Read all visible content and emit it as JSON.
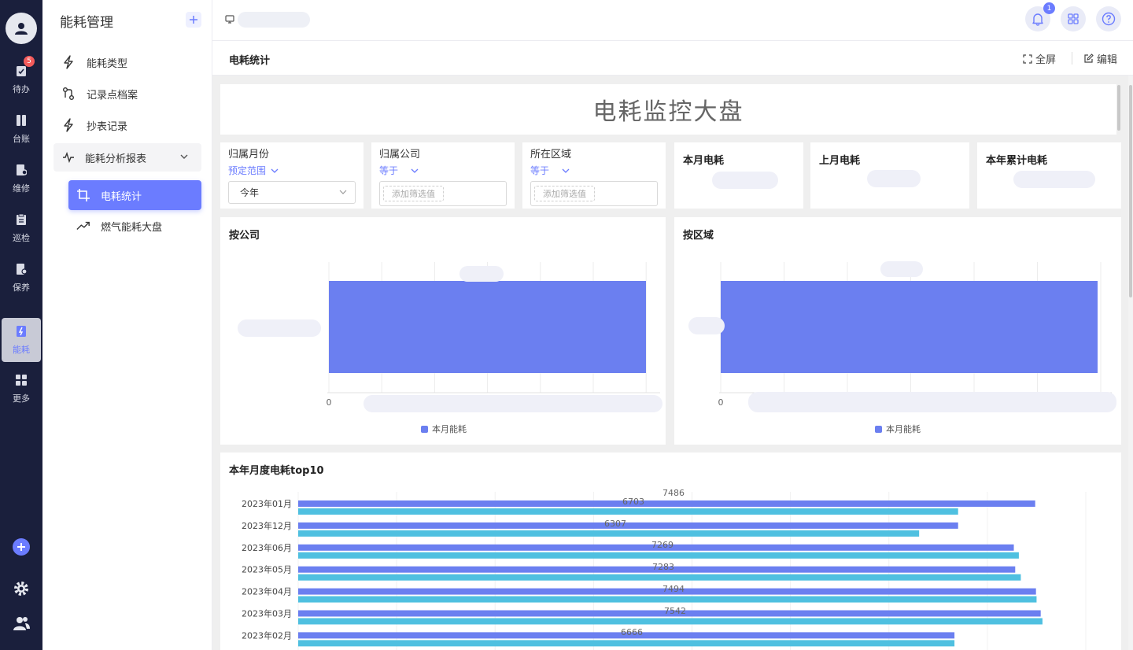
{
  "rail": {
    "items": [
      {
        "label": "待办",
        "icon": "clipboard-check-icon",
        "badge": "5"
      },
      {
        "label": "台账",
        "icon": "ledger-icon"
      },
      {
        "label": "维修",
        "icon": "repair-doc-icon"
      },
      {
        "label": "巡检",
        "icon": "inspection-icon"
      },
      {
        "label": "保养",
        "icon": "maintenance-icon"
      },
      {
        "label": "能耗",
        "icon": "energy-icon"
      },
      {
        "label": "更多",
        "icon": "grid-more-icon"
      }
    ]
  },
  "sidebar": {
    "title": "能耗管理",
    "items": [
      {
        "label": "能耗类型",
        "icon": "lightning-icon"
      },
      {
        "label": "记录点档案",
        "icon": "branch-icon"
      },
      {
        "label": "抄表记录",
        "icon": "lightning-icon"
      },
      {
        "label": "能耗分析报表",
        "icon": "activity-icon"
      }
    ],
    "subitems": [
      {
        "label": "电耗统计",
        "icon": "crop-icon"
      },
      {
        "label": "燃气能耗大盘",
        "icon": "trend-up-icon"
      }
    ]
  },
  "header": {
    "notification_count": "1"
  },
  "page": {
    "title": "电耗统计",
    "fullscreen_label": "全屏",
    "edit_label": "编辑"
  },
  "dashboard": {
    "banner": "电耗监控大盘",
    "filters": [
      {
        "label": "归属月份",
        "operator": "预定范围",
        "value": "今年"
      },
      {
        "label": "归属公司",
        "operator": "等于",
        "placeholder": "添加筛选值"
      },
      {
        "label": "所在区域",
        "operator": "等于",
        "placeholder": "添加筛选值"
      }
    ],
    "kpis": [
      {
        "title": "本月电耗"
      },
      {
        "title": "上月电耗"
      },
      {
        "title": "本年累计电耗"
      }
    ]
  },
  "chart_data": [
    {
      "type": "bar",
      "title": "按公司",
      "orientation": "horizontal",
      "x_tick_labels": [
        "0"
      ],
      "series": [
        {
          "name": "本月能耗",
          "color": "#6b7ff0",
          "values": [
            1
          ]
        }
      ],
      "grid": true,
      "legend_position": "bottom"
    },
    {
      "type": "bar",
      "title": "按区域",
      "orientation": "horizontal",
      "x_tick_labels": [
        "0"
      ],
      "series": [
        {
          "name": "本月能耗",
          "color": "#6b7ff0",
          "values": [
            1
          ]
        }
      ],
      "grid": true,
      "legend_position": "bottom"
    },
    {
      "type": "bar",
      "title": "本年月度电耗top10",
      "orientation": "horizontal",
      "categories": [
        "2023年01月",
        "2023年12月",
        "2023年06月",
        "2023年05月",
        "2023年04月",
        "2023年03月",
        "2023年02月"
      ],
      "series": [
        {
          "color": "#6b7ff0",
          "values": [
            7486,
            6703,
            7269,
            7283,
            7494,
            7542,
            6666
          ]
        },
        {
          "color": "#4fc0e0",
          "values": [
            6703,
            6307,
            7320,
            7340,
            7500,
            7560,
            6666
          ]
        }
      ],
      "data_labels": [
        "7486",
        "6703",
        "6307",
        "7269",
        "7283",
        "7494",
        "7542",
        "6666"
      ],
      "xlim": [
        0,
        8000
      ],
      "grid": true
    }
  ]
}
